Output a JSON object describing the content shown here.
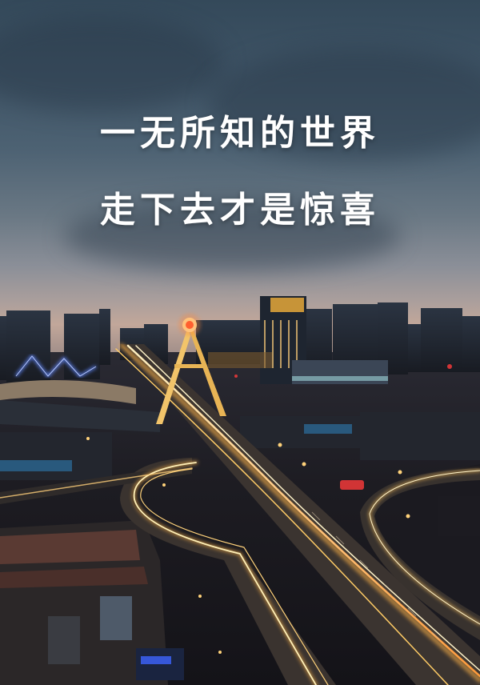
{
  "poster": {
    "line1": "一无所知的世界",
    "line2": "走下去才是惊喜"
  },
  "colors": {
    "sky_top": "#34495a",
    "horizon_glow": "#c2a79a",
    "light_trail": "#ffd27a",
    "city_dark": "#1d1c22"
  }
}
